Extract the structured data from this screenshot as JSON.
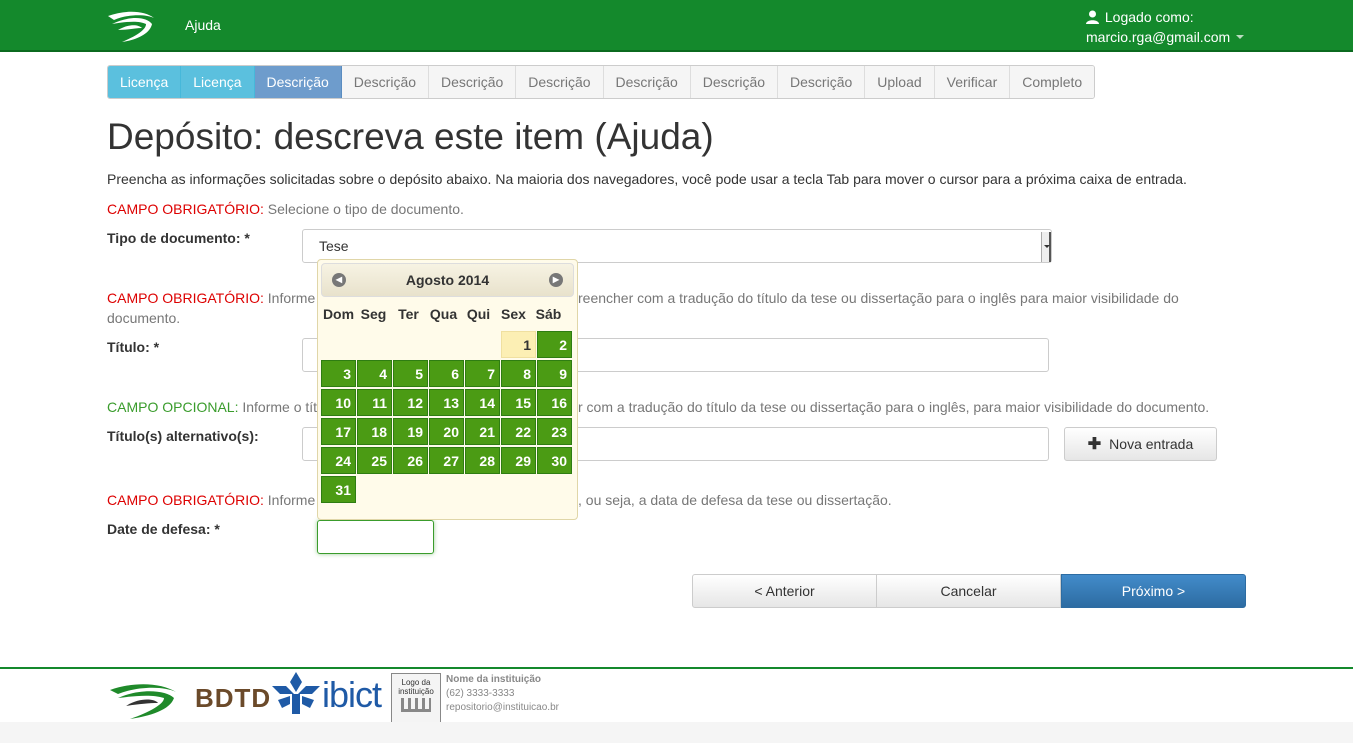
{
  "header": {
    "help_label": "Ajuda",
    "logged_label": "Logado como:",
    "user_email": "marcio.rga@gmail.com"
  },
  "steps": [
    {
      "label": "Licença",
      "state": "done"
    },
    {
      "label": "Licença",
      "state": "done"
    },
    {
      "label": "Descrição",
      "state": "current"
    },
    {
      "label": "Descrição",
      "state": "todo"
    },
    {
      "label": "Descrição",
      "state": "todo"
    },
    {
      "label": "Descrição",
      "state": "todo"
    },
    {
      "label": "Descrição",
      "state": "todo"
    },
    {
      "label": "Descrição",
      "state": "todo"
    },
    {
      "label": "Descrição",
      "state": "todo"
    },
    {
      "label": "Upload",
      "state": "todo"
    },
    {
      "label": "Verificar",
      "state": "todo"
    },
    {
      "label": "Completo",
      "state": "todo"
    }
  ],
  "page": {
    "title": "Depósito: descreva este item (Ajuda)",
    "intro": "Preencha as informações solicitadas sobre o depósito abaixo. Na maioria dos navegadores, você pode usar a tecla Tab para mover o cursor para a próxima caixa de entrada."
  },
  "fields": {
    "tipo": {
      "required_tag": "CAMPO OBRIGATÓRIO:",
      "hint": " Selecione o tipo de documento.",
      "label": "Tipo de documento: *",
      "value": "Tese"
    },
    "titulo": {
      "required_tag": "CAMPO OBRIGATÓRIO:",
      "hint_start": " Informe",
      "hint_end": "reencher com a tradução do título da tese ou dissertação para o inglês para maior visibilidade do",
      "hint_line2": "documento.",
      "label": "Título: *"
    },
    "titulo_alt": {
      "optional_tag": "CAMPO OPCIONAL:",
      "hint_start": " Informe o tít",
      "hint_end": "r com a tradução do título da tese ou dissertação para o inglês, para maior visibilidade do documento.",
      "label": "Título(s) alternativo(s):",
      "add_button": "Nova entrada"
    },
    "data_defesa": {
      "required_tag": "CAMPO OBRIGATÓRIO:",
      "hint_start": " Informe",
      "hint_end": ", ou seja, a data de defesa da tese ou dissertação.",
      "label": "Date de defesa: *"
    }
  },
  "calendar": {
    "month_label": "Agosto 2014",
    "weekdays": [
      "Dom",
      "Seg",
      "Ter",
      "Qua",
      "Qui",
      "Sex",
      "Sáb"
    ],
    "first_weekday_index": 5,
    "days_in_month": 31,
    "today": 1
  },
  "buttons": {
    "prev": "< Anterior",
    "cancel": "Cancelar",
    "next": "Próximo >"
  },
  "footer": {
    "bdtd": "BDTD",
    "ibict": "ibict",
    "inst_logo": "Logo da instituição",
    "inst_name": "Nome da instituição",
    "inst_phone": "(62) 3333-3333",
    "inst_email": "repositorio@instituicao.br"
  },
  "colors": {
    "brand_green": "#14892c",
    "step_done": "#5bc0de",
    "step_current": "#6e9ccc",
    "primary": "#428bca",
    "required": "#dd0000",
    "optional": "#3a9c2c",
    "calendar_day": "#4b9b14"
  }
}
